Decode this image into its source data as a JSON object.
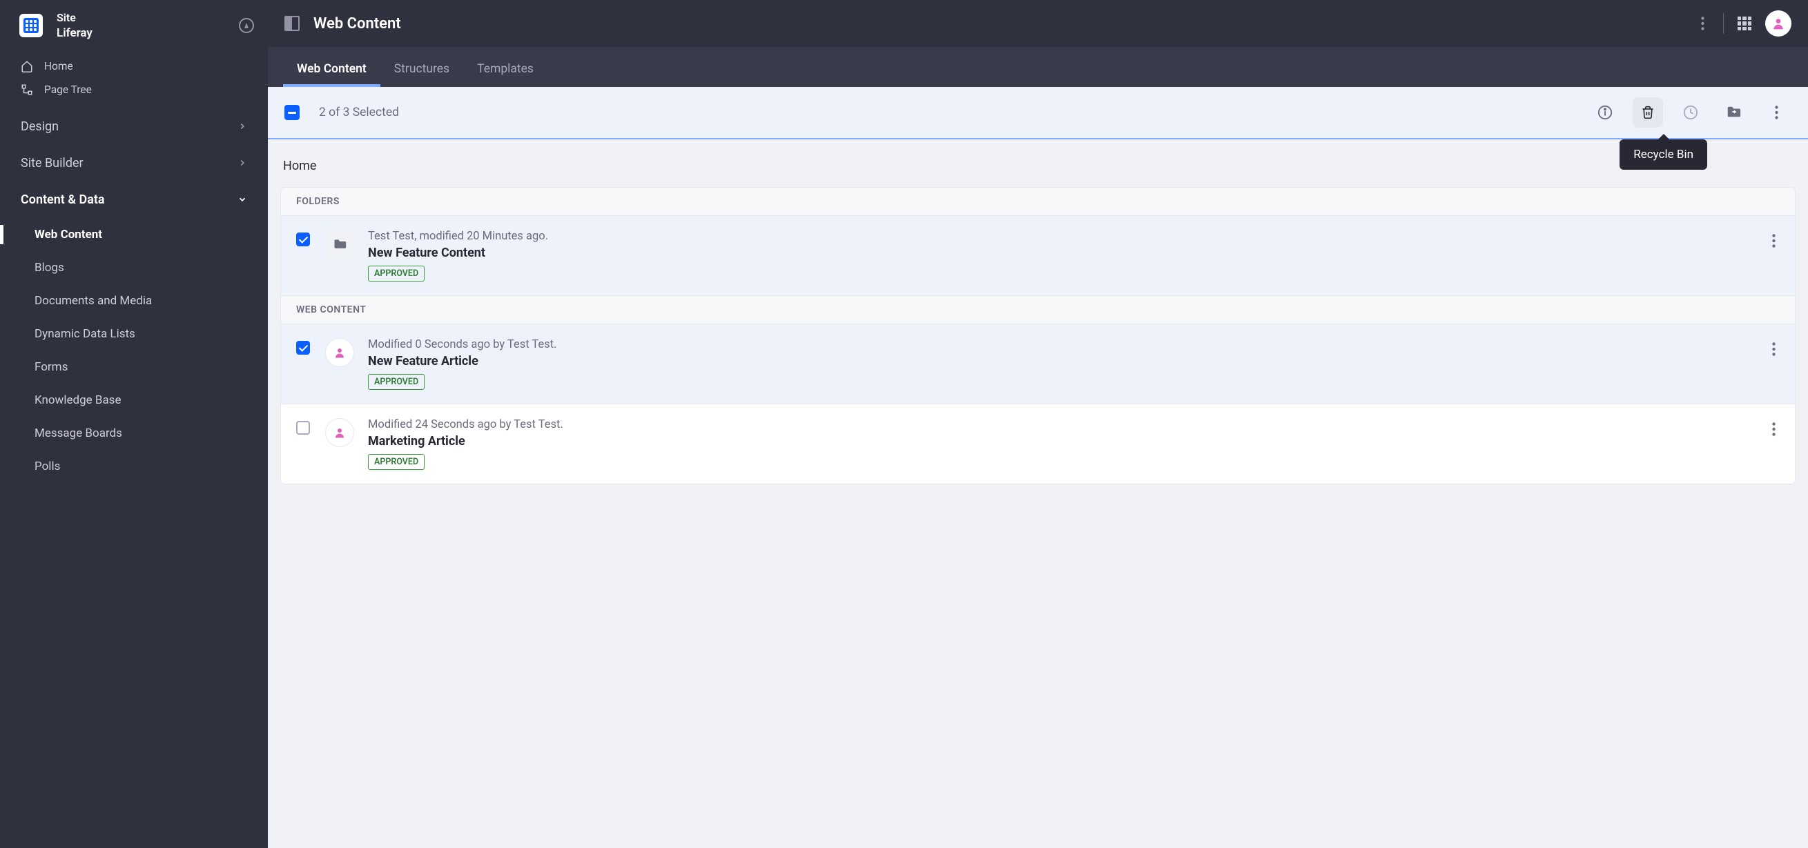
{
  "brand": {
    "label1": "Site",
    "label2": "Liferay"
  },
  "sidebar": {
    "quick": [
      {
        "label": "Home"
      },
      {
        "label": "Page Tree"
      }
    ],
    "sections": [
      {
        "label": "Design",
        "open": false
      },
      {
        "label": "Site Builder",
        "open": false
      },
      {
        "label": "Content & Data",
        "open": true
      }
    ],
    "subitems": [
      {
        "label": "Web Content",
        "active": true
      },
      {
        "label": "Blogs"
      },
      {
        "label": "Documents and Media"
      },
      {
        "label": "Dynamic Data Lists"
      },
      {
        "label": "Forms"
      },
      {
        "label": "Knowledge Base"
      },
      {
        "label": "Message Boards"
      },
      {
        "label": "Polls"
      }
    ]
  },
  "topbar": {
    "title": "Web Content"
  },
  "tabs": [
    {
      "label": "Web Content",
      "active": true
    },
    {
      "label": "Structures"
    },
    {
      "label": "Templates"
    }
  ],
  "selectionBar": {
    "text": "2 of 3 Selected",
    "tooltip": "Recycle Bin"
  },
  "breadcrumb": "Home",
  "sections": {
    "folders": {
      "header": "FOLDERS",
      "items": [
        {
          "meta": "Test Test, modified 20 Minutes ago.",
          "title": "New Feature Content",
          "badge": "APPROVED",
          "checked": true
        }
      ]
    },
    "webcontent": {
      "header": "WEB CONTENT",
      "items": [
        {
          "meta": "Modified 0 Seconds ago by Test Test.",
          "title": "New Feature Article",
          "badge": "APPROVED",
          "checked": true
        },
        {
          "meta": "Modified 24 Seconds ago by Test Test.",
          "title": "Marketing Article",
          "badge": "APPROVED",
          "checked": false
        }
      ]
    }
  }
}
